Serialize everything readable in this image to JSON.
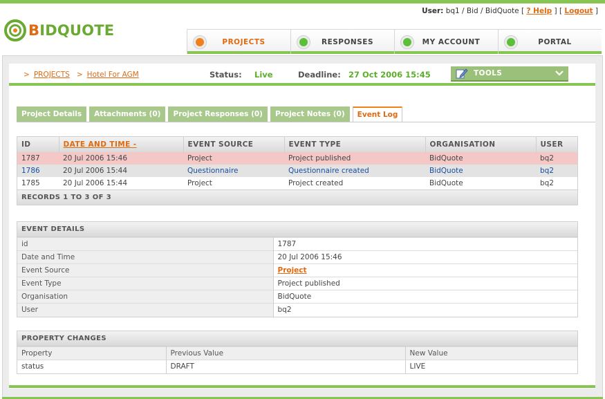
{
  "user_bar": {
    "label": "User:",
    "info": "bq1 / Bid / BidQuote",
    "help": "? Help",
    "logout": "Logout"
  },
  "brand": {
    "name_prefix": "B",
    "name_rest": "IDQUOTE"
  },
  "nav": [
    {
      "label": "PROJECTS",
      "active": true
    },
    {
      "label": "RESPONSES",
      "active": false
    },
    {
      "label": "MY ACCOUNT",
      "active": false
    },
    {
      "label": "PORTAL",
      "active": false
    }
  ],
  "breadcrumb": {
    "separator": ">",
    "items": [
      "PROJECTS",
      "Hotel For AGM"
    ]
  },
  "status": {
    "label": "Status:",
    "value": "Live"
  },
  "deadline": {
    "label": "Deadline:",
    "value": "27 Oct 2006 15:45"
  },
  "tools": {
    "label": "TOOLS"
  },
  "subtabs": [
    {
      "label": "Project Details",
      "active": false
    },
    {
      "label": "Attachments (0)",
      "active": false
    },
    {
      "label": "Project Responses (0)",
      "active": false
    },
    {
      "label": "Project Notes (0)",
      "active": false
    },
    {
      "label": "Event Log",
      "active": true
    }
  ],
  "event_table": {
    "columns": [
      "ID",
      "DATE AND TIME -",
      "EVENT SOURCE",
      "EVENT TYPE",
      "ORGANISATION",
      "USER"
    ],
    "rows": [
      {
        "id": "1787",
        "date": "20 Jul 2006 15:46",
        "source": "Project",
        "type": "Project published",
        "org": "BidQuote",
        "user": "bq2"
      },
      {
        "id": "1786",
        "date": "20 Jul 2006 15:44",
        "source": "Questionnaire",
        "type": "Questionnaire created",
        "org": "BidQuote",
        "user": "bq2"
      },
      {
        "id": "1785",
        "date": "20 Jul 2006 15:44",
        "source": "Project",
        "type": "Project created",
        "org": "BidQuote",
        "user": "bq2"
      }
    ],
    "footer": "RECORDS 1 TO 3 OF 3"
  },
  "event_details": {
    "title": "EVENT DETAILS",
    "rows": [
      {
        "key": "id",
        "value": "1787"
      },
      {
        "key": "Date and Time",
        "value": "20 Jul 2006 15:46"
      },
      {
        "key": "Event Source",
        "value": "Project"
      },
      {
        "key": "Event Type",
        "value": "Project published"
      },
      {
        "key": "Organisation",
        "value": "BidQuote"
      },
      {
        "key": "User",
        "value": "bq2"
      }
    ]
  },
  "property_changes": {
    "title": "PROPERTY CHANGES",
    "headers": [
      "Property",
      "Previous Value",
      "New Value"
    ],
    "rows": [
      {
        "property": "status",
        "previous": "DRAFT",
        "new": "LIVE"
      }
    ]
  },
  "colors": {
    "accent_green": "#86c552",
    "accent_orange": "#e06a10",
    "selected_row": "#f5c8c8"
  }
}
